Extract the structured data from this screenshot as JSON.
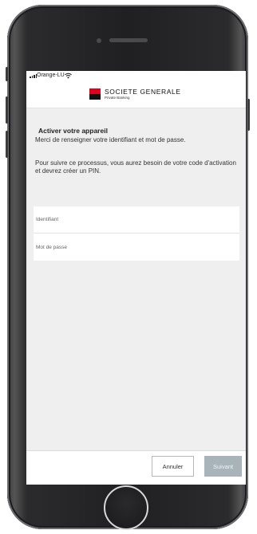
{
  "status_bar": {
    "carrier": "Orange-LU",
    "signal_icon": "signal-bars-icon",
    "wifi_icon": "wifi-icon"
  },
  "header": {
    "brand_name": "SOCIETE GENERALE",
    "brand_subtitle": "Private Banking",
    "logo_colors": {
      "top": "#e2001a",
      "bottom": "#111111"
    }
  },
  "main": {
    "title": "Activer votre appareil",
    "intro": "Merci de renseigner votre identifiant et mot de passe.",
    "info": "Pour suivre ce processus, vous aurez besoin de votre code d'activation et devrez créer un PIN."
  },
  "form": {
    "username": {
      "value": "",
      "placeholder": "Identifiant"
    },
    "password": {
      "value": "",
      "placeholder": "Mot de passe"
    }
  },
  "footer": {
    "cancel_label": "Annuler",
    "next_label": "Suivant"
  },
  "colors": {
    "next_button_disabled": "#a9b3ba",
    "screen_background": "#efefef"
  }
}
